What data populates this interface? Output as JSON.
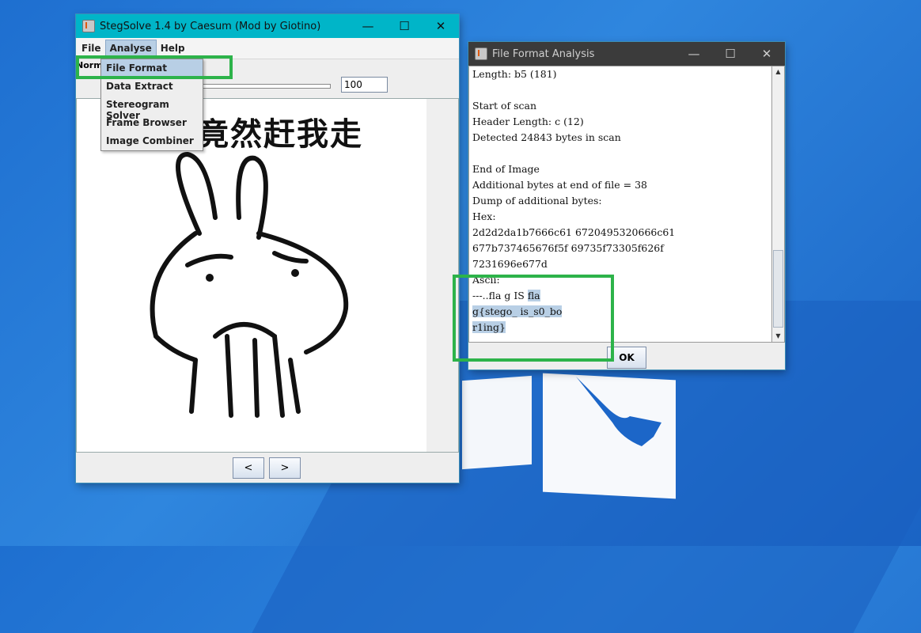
{
  "steg": {
    "title": "StegSolve 1.4 by Caesum (Mod by Giotino)",
    "menus": [
      "File",
      "Analyse",
      "Help"
    ],
    "mode_label": "Norm",
    "zoom_value": "100",
    "meme_text": "竟然赶我走",
    "prev_label": "<",
    "next_label": ">",
    "analyse_menu": [
      "File Format",
      "Data Extract",
      "Stereogram Solver",
      "Frame Browser",
      "Image Combiner"
    ]
  },
  "ffa": {
    "title": "File Format Analysis",
    "lines": [
      "Length: b5 (181)",
      "",
      "Start of scan",
      "Header Length: c (12)",
      "Detected 24843 bytes in scan",
      "",
      "End of Image",
      "Additional bytes at end of file = 38",
      "Dump of additional bytes:",
      "Hex:",
      "2d2d2da1b7666c61 6720495320666c61",
      "677b737465676f5f 69735f73305f626f",
      "7231696e677d",
      "Ascii:"
    ],
    "ascii_lines": [
      {
        "plain": "---..fla g IS ",
        "highlight": "fla"
      },
      {
        "plain": "",
        "highlight": "g{stego_ is_s0_bo"
      },
      {
        "plain": "",
        "highlight": "r1ing}"
      }
    ],
    "ok_label": "OK"
  },
  "icons": {
    "minimize": "—",
    "maximize": "☐",
    "close": "✕",
    "scroll_up": "▲",
    "scroll_down": "▼"
  },
  "colors": {
    "highlight_box": "#2db34a",
    "steg_titlebar": "#00b5c8",
    "ffa_titlebar": "#3b3b3b",
    "selection": "#b8cfe5"
  }
}
